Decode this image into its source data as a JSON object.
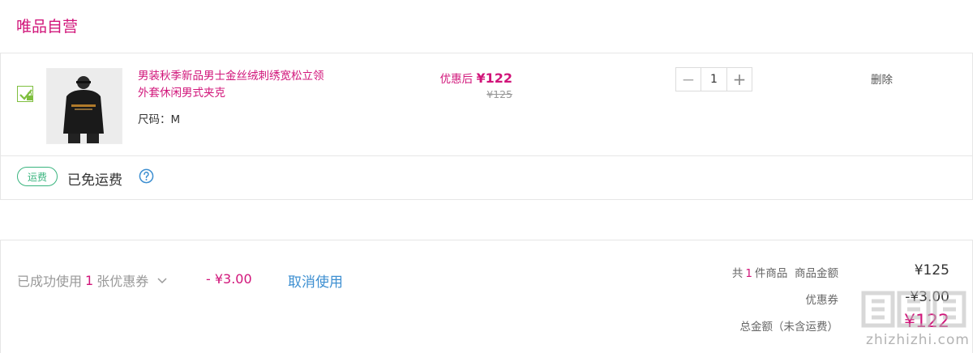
{
  "store": {
    "title": "唯品自营"
  },
  "cart_item": {
    "checked": true,
    "product_title": "男装秋季新品男士金丝绒刺绣宽松立领外套休闲男式夹克",
    "size_label": "尺码：",
    "size_value": "M",
    "price_after_label": "优惠后",
    "price_after": "¥122",
    "price_original": "¥125",
    "quantity": "1",
    "minus_symbol": "−",
    "plus_symbol": "+",
    "delete_label": "删除"
  },
  "shipping": {
    "badge": "运费",
    "text": "已免运费",
    "help_icon": "question-circle-icon"
  },
  "summary": {
    "coupon_prefix": "已成功使用",
    "coupon_count": "1",
    "coupon_suffix": "张优惠券",
    "coupon_amount": "- ¥3.00",
    "cancel_label": "取消使用",
    "items_prefix": "共",
    "items_count": "1",
    "items_suffix": "件商品",
    "goods_amount_label": "商品金额",
    "goods_amount": "¥125",
    "coupon_label": "优惠券",
    "coupon_value": "-¥3.00",
    "total_label": "总金额（未含运费）",
    "total_value": "¥122"
  },
  "watermark": {
    "text": "zhizhizhi.com",
    "logo": "zhizhizhi-logo"
  },
  "colors": {
    "accent": "#d1157a",
    "link": "#3d8fd1",
    "shipping_green": "#39b47e",
    "check_green": "#7fbf3f"
  }
}
